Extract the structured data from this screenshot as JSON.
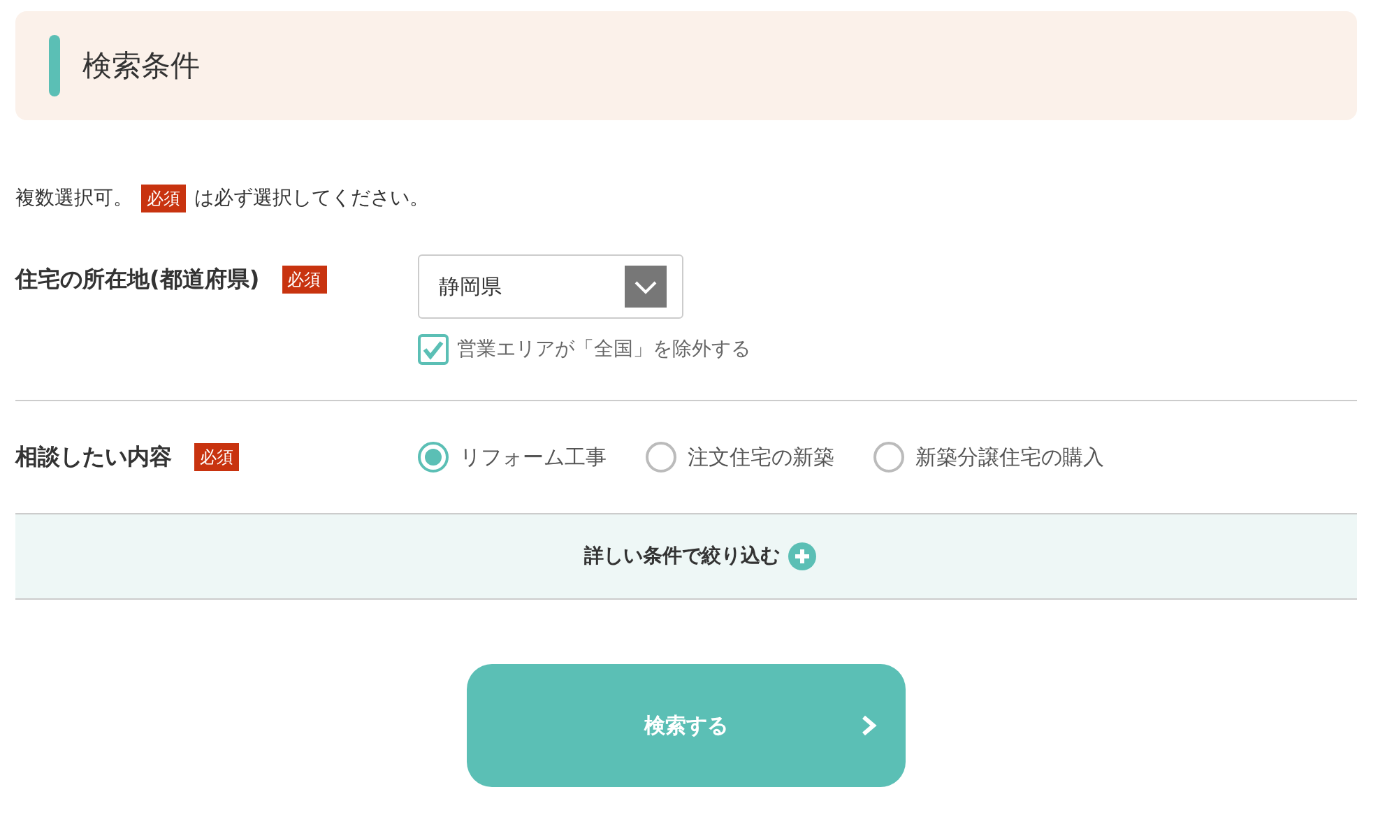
{
  "heading": {
    "title": "検索条件"
  },
  "intro": {
    "before": "複数選択可。",
    "badge": "必須",
    "after": "は必ず選択してください。"
  },
  "fields": [
    {
      "kind": "select",
      "label": "住宅の所在地(都道府県)",
      "badge": "必須",
      "value": "静岡県",
      "option": {
        "label": "営業エリアが「全国」を除外する",
        "checked": true
      }
    },
    {
      "kind": "radio",
      "label": "相談したい内容",
      "badge": "必須",
      "choices": [
        {
          "label": "リフォーム工事",
          "selected": true
        },
        {
          "label": "注文住宅の新築",
          "selected": false
        },
        {
          "label": "新築分譲住宅の購入",
          "selected": false
        }
      ]
    }
  ],
  "more_filters": {
    "label": "詳しい条件で絞り込む"
  },
  "submit": {
    "label": "検索する"
  }
}
